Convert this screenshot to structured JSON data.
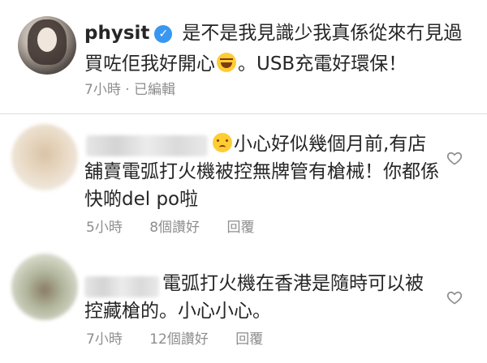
{
  "post": {
    "username": "physit",
    "caption_part1": "是不是我見識少我真係從來冇見過買咗佢我好開心",
    "caption_part2": "。USB充電好環保！",
    "time": "7小時",
    "separator": "·",
    "edited": "已編輯"
  },
  "comments": [
    {
      "text": "小心好似幾個月前,有店舖賣電弧打火機被控無牌管有槍械！你都係快啲del po啦",
      "time": "5小時",
      "likes": "8個讚好",
      "reply": "回覆"
    },
    {
      "text": "電弧打火機在香港是隨時可以被控藏槍的。小心小心。",
      "time": "7小時",
      "likes": "12個讚好",
      "reply": "回覆"
    }
  ],
  "icons": {
    "verified": "verified-badge-icon",
    "laugh": "tears-of-joy-emoji",
    "worried": "worried-face-emoji",
    "like": "heart-outline-icon"
  },
  "colors": {
    "verified_blue": "#3897f0",
    "meta_gray": "#8e8e8e",
    "text": "#262626"
  }
}
